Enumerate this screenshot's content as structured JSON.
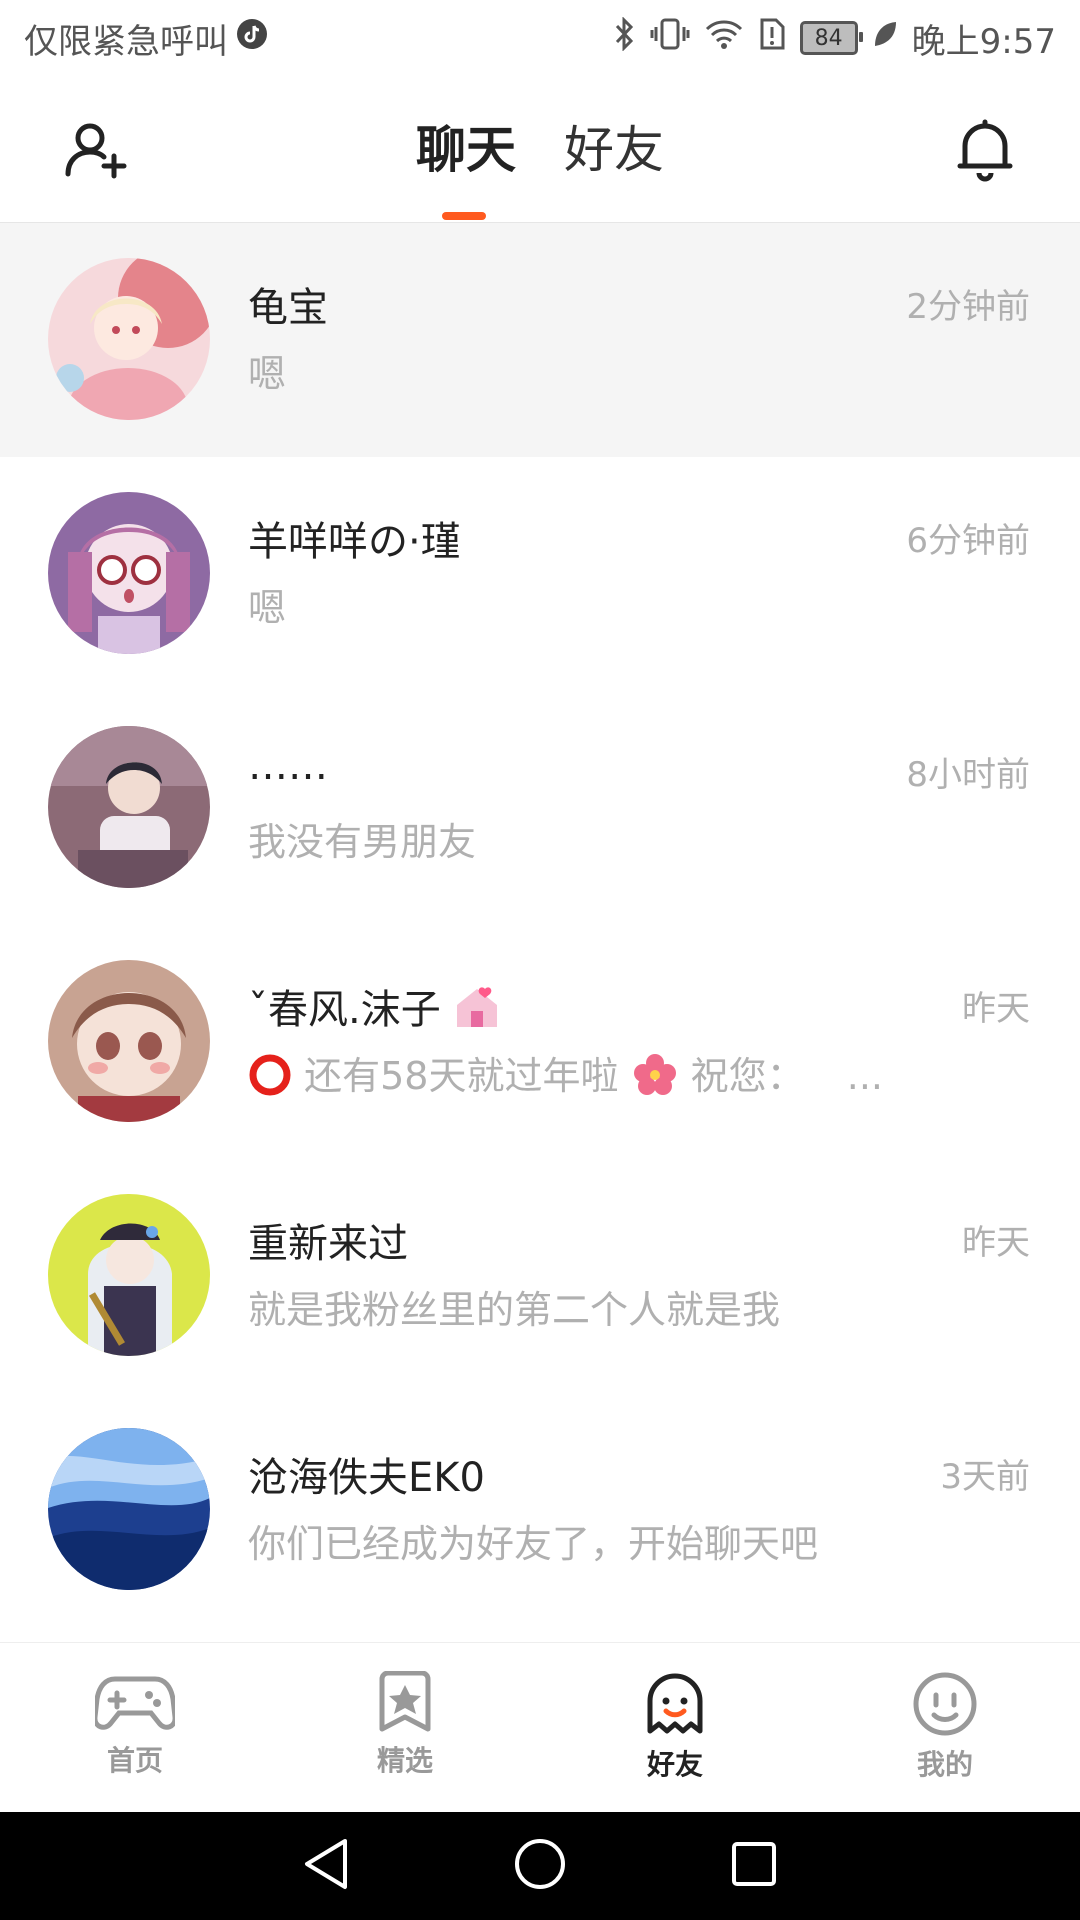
{
  "status_bar": {
    "left_text": "仅限紧急呼叫",
    "battery": "84",
    "time": "晚上9:57"
  },
  "header": {
    "tabs": [
      {
        "label": "聊天",
        "active": true
      },
      {
        "label": "好友",
        "active": false
      }
    ],
    "accent_color": "#ff5a1f"
  },
  "chats": [
    {
      "name": "龟宝",
      "preview": "嗯",
      "time": "2分钟前"
    },
    {
      "name": "羊咩咩の·瑾",
      "preview": "嗯",
      "time": "6分钟前"
    },
    {
      "name": "……",
      "preview": "我没有男朋友",
      "time": "8小时前"
    },
    {
      "name": "ˇ春风.沫子",
      "preview": "还有58天就过年啦",
      "preview_tail": "祝您：",
      "ellipsis": "...",
      "time": "昨天"
    },
    {
      "name": "重新来过",
      "preview": "就是我粉丝里的第二个人就是我",
      "time": "昨天"
    },
    {
      "name": "沧海佚夫EK0",
      "preview": "你们已经成为好友了，开始聊天吧",
      "time": "3天前"
    }
  ],
  "bottom_nav": [
    {
      "label": "首页",
      "icon": "gamepad-icon",
      "active": false
    },
    {
      "label": "精选",
      "icon": "star-bookmark-icon",
      "active": false
    },
    {
      "label": "好友",
      "icon": "ghost-icon",
      "active": true
    },
    {
      "label": "我的",
      "icon": "smiley-face-icon",
      "active": false
    }
  ]
}
